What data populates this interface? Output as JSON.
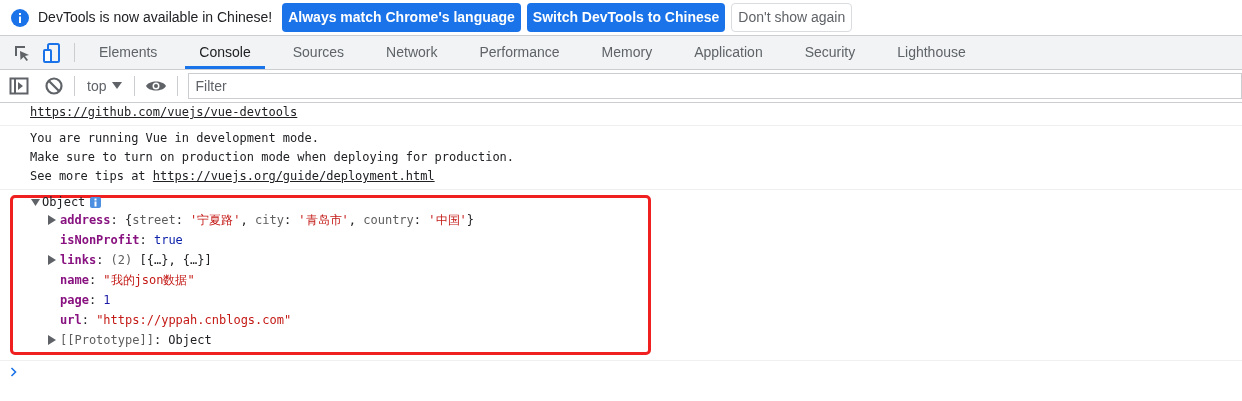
{
  "infobar": {
    "message": "DevTools is now available in Chinese!",
    "buttons": [
      {
        "label": "Always match Chrome's language",
        "kind": "primary"
      },
      {
        "label": "Switch DevTools to Chinese",
        "kind": "primary"
      },
      {
        "label": "Don't show again",
        "kind": "secondary"
      }
    ]
  },
  "tabs": [
    {
      "label": "Elements",
      "selected": false
    },
    {
      "label": "Console",
      "selected": true
    },
    {
      "label": "Sources",
      "selected": false
    },
    {
      "label": "Network",
      "selected": false
    },
    {
      "label": "Performance",
      "selected": false
    },
    {
      "label": "Memory",
      "selected": false
    },
    {
      "label": "Application",
      "selected": false
    },
    {
      "label": "Security",
      "selected": false
    },
    {
      "label": "Lighthouse",
      "selected": false
    }
  ],
  "console_toolbar": {
    "context": "top",
    "filter": {
      "placeholder": "Filter"
    }
  },
  "messages": [
    {
      "lines": [
        [
          {
            "kind": "link",
            "text": "https://github.com/vuejs/vue-devtools"
          }
        ]
      ]
    },
    {
      "lines": [
        [
          {
            "kind": "text",
            "text": "You are running Vue in development mode."
          }
        ],
        [
          {
            "kind": "text",
            "text": "Make sure to turn on production mode when deploying for production."
          }
        ],
        [
          {
            "kind": "text",
            "text": "See more tips at "
          },
          {
            "kind": "link",
            "text": "https://vuejs.org/guide/deployment.html"
          }
        ]
      ]
    },
    {
      "object": {
        "label": "Object",
        "expanded": true,
        "highlighted": true,
        "properties": [
          {
            "key": "address",
            "internal": false,
            "expandable": true,
            "value": [
              {
                "kind": "punct",
                "text": ": {"
              },
              {
                "kind": "preview_key",
                "text": "street"
              },
              {
                "kind": "punct",
                "text": ": "
              },
              {
                "kind": "string",
                "text": "'宁夏路'"
              },
              {
                "kind": "punct",
                "text": ", "
              },
              {
                "kind": "preview_key",
                "text": "city"
              },
              {
                "kind": "punct",
                "text": ": "
              },
              {
                "kind": "string",
                "text": "'青岛市'"
              },
              {
                "kind": "punct",
                "text": ", "
              },
              {
                "kind": "preview_key",
                "text": "country"
              },
              {
                "kind": "punct",
                "text": ": "
              },
              {
                "kind": "string",
                "text": "'中国'"
              },
              {
                "kind": "punct",
                "text": "}"
              }
            ]
          },
          {
            "key": "isNonProfit",
            "internal": false,
            "expandable": false,
            "value": [
              {
                "kind": "punct",
                "text": ": "
              },
              {
                "kind": "keyword",
                "text": "true"
              }
            ]
          },
          {
            "key": "links",
            "internal": false,
            "expandable": true,
            "value": [
              {
                "kind": "punct",
                "text": ": "
              },
              {
                "kind": "preview_key",
                "text": "(2) "
              },
              {
                "kind": "punct",
                "text": "[{…}, {…}]"
              }
            ]
          },
          {
            "key": "name",
            "internal": false,
            "expandable": false,
            "value": [
              {
                "kind": "punct",
                "text": ": "
              },
              {
                "kind": "string",
                "text": "\"我的json数据\""
              }
            ]
          },
          {
            "key": "page",
            "internal": false,
            "expandable": false,
            "value": [
              {
                "kind": "punct",
                "text": ": "
              },
              {
                "kind": "number",
                "text": "1"
              }
            ]
          },
          {
            "key": "url",
            "internal": false,
            "expandable": false,
            "value": [
              {
                "kind": "punct",
                "text": ": "
              },
              {
                "kind": "string",
                "text": "\"https://yppah.cnblogs.com\""
              }
            ]
          },
          {
            "key": "[[Prototype]]",
            "internal": true,
            "expandable": true,
            "value": [
              {
                "kind": "punct",
                "text": ": Object"
              }
            ]
          }
        ]
      }
    }
  ]
}
